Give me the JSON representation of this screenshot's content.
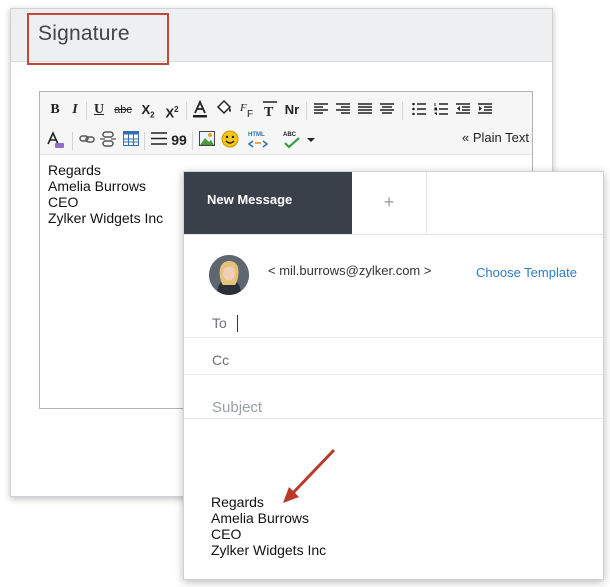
{
  "signature_panel": {
    "title": "Signature",
    "toolbar": {
      "bold_label": "B",
      "italic_label": "I",
      "underline_label": "U",
      "strike_label": "abc",
      "subscript_label": "X",
      "superscript_label": "X",
      "clear_format_label": "T",
      "nr_label": "Nr",
      "quote_label": "99",
      "html_label": "HTML",
      "spell_label": "ABC",
      "plain_text_label": "« Plain Text"
    },
    "content_lines": [
      "Regards",
      "Amelia Burrows",
      "CEO",
      "Zylker Widgets Inc"
    ]
  },
  "message_window": {
    "tabs": [
      {
        "label": "New Message"
      },
      {
        "label": "+"
      }
    ],
    "from_address": "< mil.burrows@zylker.com >",
    "choose_template_label": "Choose Template",
    "to_label": "To",
    "cc_label": "Cc",
    "subject_placeholder": "Subject",
    "body_lines": [
      "Regards",
      "Amelia Burrows",
      "CEO",
      "Zylker Widgets Inc"
    ]
  },
  "colors": {
    "highlight_border": "#c0473a",
    "active_tab_bg": "#3a4049",
    "link": "#2d7cc4",
    "arrow": "#b93a2d"
  }
}
